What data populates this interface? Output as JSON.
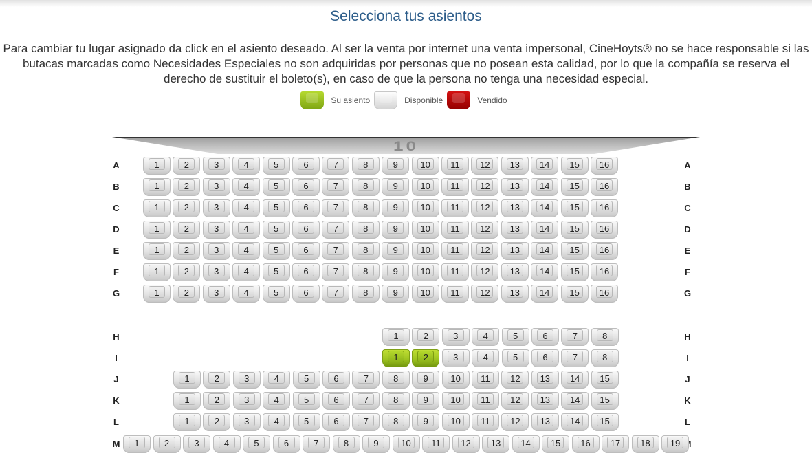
{
  "page": {
    "title": "Selecciona tus asientos",
    "notice": "Para cambiar tu lugar asignado da click en el asiento deseado. Al ser la venta por internet una venta impersonal, CineHoyts® no se hace responsable si las butacas marcadas como Necesidades Especiales no son adquiridas por personas que no posean esta calidad, por lo que la compañía se reserva el derecho de sustituir el boleto(s), en caso de que la persona no tenga una necesidad especial."
  },
  "legend": {
    "selected_label": "Su asiento",
    "available_label": "Disponible",
    "sold_label": "Vendido"
  },
  "screen": {
    "label": "10"
  },
  "colors": {
    "selected": "#9ec420",
    "available": "#e2e2e2",
    "sold": "#b00000",
    "title": "#2d5d8a"
  },
  "rows": [
    {
      "label": "A",
      "seats": [
        "1",
        "2",
        "3",
        "4",
        "5",
        "6",
        "7",
        "8",
        "9",
        "10",
        "11",
        "12",
        "13",
        "14",
        "15",
        "16"
      ]
    },
    {
      "label": "B",
      "seats": [
        "1",
        "2",
        "3",
        "4",
        "5",
        "6",
        "7",
        "8",
        "9",
        "10",
        "11",
        "12",
        "13",
        "14",
        "15",
        "16"
      ]
    },
    {
      "label": "C",
      "seats": [
        "1",
        "2",
        "3",
        "4",
        "5",
        "6",
        "7",
        "8",
        "9",
        "10",
        "11",
        "12",
        "13",
        "14",
        "15",
        "16"
      ]
    },
    {
      "label": "D",
      "seats": [
        "1",
        "2",
        "3",
        "4",
        "5",
        "6",
        "7",
        "8",
        "9",
        "10",
        "11",
        "12",
        "13",
        "14",
        "15",
        "16"
      ]
    },
    {
      "label": "E",
      "seats": [
        "1",
        "2",
        "3",
        "4",
        "5",
        "6",
        "7",
        "8",
        "9",
        "10",
        "11",
        "12",
        "13",
        "14",
        "15",
        "16"
      ]
    },
    {
      "label": "F",
      "seats": [
        "1",
        "2",
        "3",
        "4",
        "5",
        "6",
        "7",
        "8",
        "9",
        "10",
        "11",
        "12",
        "13",
        "14",
        "15",
        "16"
      ]
    },
    {
      "label": "G",
      "seats": [
        "1",
        "2",
        "3",
        "4",
        "5",
        "6",
        "7",
        "8",
        "9",
        "10",
        "11",
        "12",
        "13",
        "14",
        "15",
        "16"
      ]
    },
    {
      "label": "H",
      "seats": [
        "1",
        "2",
        "3",
        "4",
        "5",
        "6",
        "7",
        "8"
      ]
    },
    {
      "label": "I",
      "seats": [
        "1",
        "2",
        "3",
        "4",
        "5",
        "6",
        "7",
        "8"
      ],
      "selected": [
        "1",
        "2"
      ]
    },
    {
      "label": "J",
      "seats": [
        "1",
        "2",
        "3",
        "4",
        "5",
        "6",
        "7",
        "8",
        "9",
        "10",
        "11",
        "12",
        "13",
        "14",
        "15"
      ]
    },
    {
      "label": "K",
      "seats": [
        "1",
        "2",
        "3",
        "4",
        "5",
        "6",
        "7",
        "8",
        "9",
        "10",
        "11",
        "12",
        "13",
        "14",
        "15"
      ]
    },
    {
      "label": "L",
      "seats": [
        "1",
        "2",
        "3",
        "4",
        "5",
        "6",
        "7",
        "8",
        "9",
        "10",
        "11",
        "12",
        "13",
        "14",
        "15"
      ]
    },
    {
      "label": "M",
      "seats": [
        "1",
        "2",
        "3",
        "4",
        "5",
        "6",
        "7",
        "8",
        "9",
        "10",
        "11",
        "12",
        "13",
        "14",
        "15",
        "16",
        "17",
        "18",
        "19"
      ]
    }
  ]
}
